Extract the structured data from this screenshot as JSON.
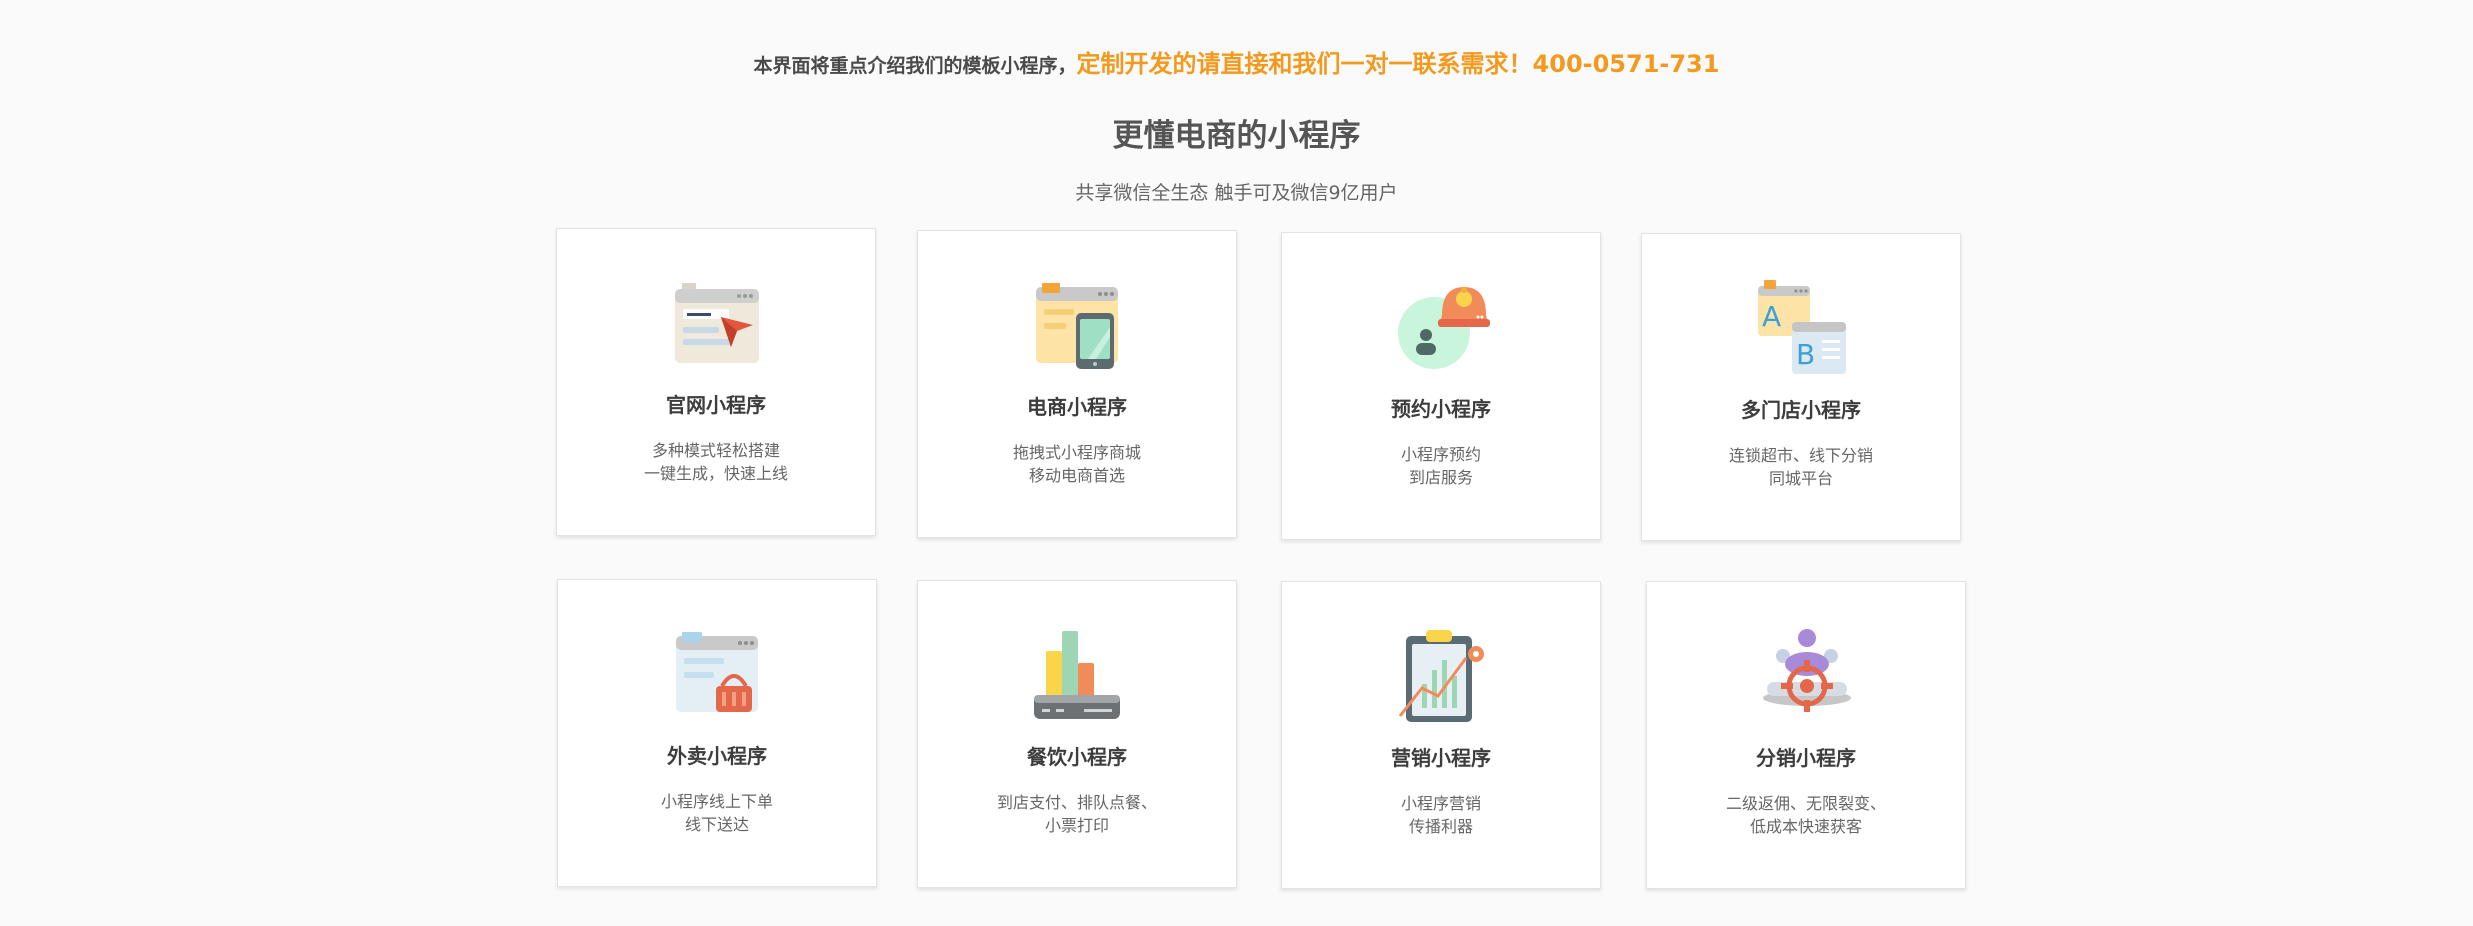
{
  "banner": {
    "intro": "本界面将重点介绍我们的模板小程序，",
    "cta": "定制开发的请直接和我们一对一联系需求！400-0571-731"
  },
  "section": {
    "title": "更懂电商的小程序",
    "subtitle": "共享微信全生态 触手可及微信9亿用户"
  },
  "cards": [
    {
      "name": "官网小程序",
      "line1": "多种模式轻松搭建",
      "line2": "一键生成，快速上线",
      "icon": "website-icon"
    },
    {
      "name": "电商小程序",
      "line1": "拖拽式小程序商城",
      "line2": "移动电商首选",
      "icon": "mobile-shop-icon"
    },
    {
      "name": "预约小程序",
      "line1": "小程序预约",
      "line2": "到店服务",
      "icon": "appointment-bell-icon"
    },
    {
      "name": "多门店小程序",
      "line1": "连锁超市、线下分销",
      "line2": "同城平台",
      "icon": "multi-store-icon"
    },
    {
      "name": "外卖小程序",
      "line1": "小程序线上下单",
      "line2": "线下送达",
      "icon": "takeout-basket-icon"
    },
    {
      "name": "餐饮小程序",
      "line1": "到店支付、排队点餐、",
      "line2": "小票打印",
      "icon": "catering-bars-icon"
    },
    {
      "name": "营销小程序",
      "line1": "小程序营销",
      "line2": "传播利器",
      "icon": "marketing-clipboard-icon"
    },
    {
      "name": "分销小程序",
      "line1": "二级返佣、无限裂变、",
      "line2": "低成本快速获客",
      "icon": "distribution-target-icon"
    }
  ],
  "colors": {
    "accent": "#f39a1e",
    "text": "#555555",
    "card_border": "#e3e3e3"
  }
}
